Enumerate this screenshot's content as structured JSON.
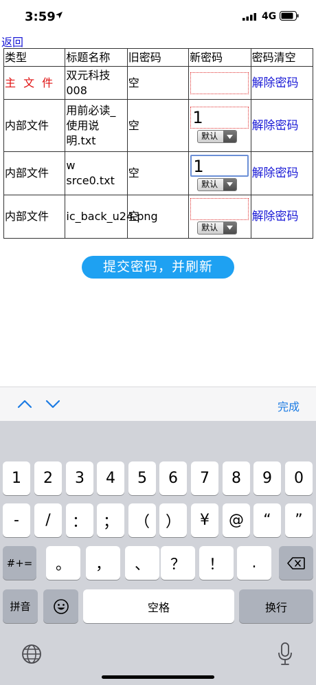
{
  "status": {
    "time": "3:59",
    "network": "4G"
  },
  "nav": {
    "back": "返回"
  },
  "table": {
    "headers": [
      "类型",
      "标题名称",
      "旧密码",
      "新密码",
      "密码清空"
    ],
    "rows": [
      {
        "type": "主 文 件",
        "title": "双元科技008",
        "old": "空",
        "new_value": "",
        "clear": "解除密码",
        "has_select": false
      },
      {
        "type": "内部文件",
        "title": "用前必读_使用说明.txt",
        "old": "空",
        "new_value": "1",
        "clear": "解除密码",
        "has_select": true,
        "select": "默认"
      },
      {
        "type": "内部文件",
        "title": "w srce0.txt",
        "old": "空",
        "new_value": "1",
        "clear": "解除密码",
        "has_select": true,
        "select": "默认",
        "focused": true
      },
      {
        "type": "内部文件",
        "title": "ic_back_u24.png",
        "old": "空",
        "new_value": "",
        "clear": "解除密码",
        "has_select": true,
        "select": "默认"
      }
    ]
  },
  "submit": "提交密码，并刷新",
  "accessory": {
    "done": "完成"
  },
  "keyboard": {
    "row1": [
      "1",
      "2",
      "3",
      "4",
      "5",
      "6",
      "7",
      "8",
      "9",
      "0"
    ],
    "row2": [
      "-",
      "/",
      "：",
      "；",
      "（",
      "）",
      "¥",
      "@",
      "“",
      "”"
    ],
    "row3_symbol": "#+=",
    "row3": [
      "。",
      "，",
      "、",
      "？",
      "！",
      "."
    ],
    "pinyin": "拼音",
    "space": "空格",
    "return": "换行"
  },
  "colors": {
    "link": "#1a1ad6",
    "main_type": "#e01010",
    "submit_bg": "#1ea1f2",
    "done": "#1b7be3"
  }
}
